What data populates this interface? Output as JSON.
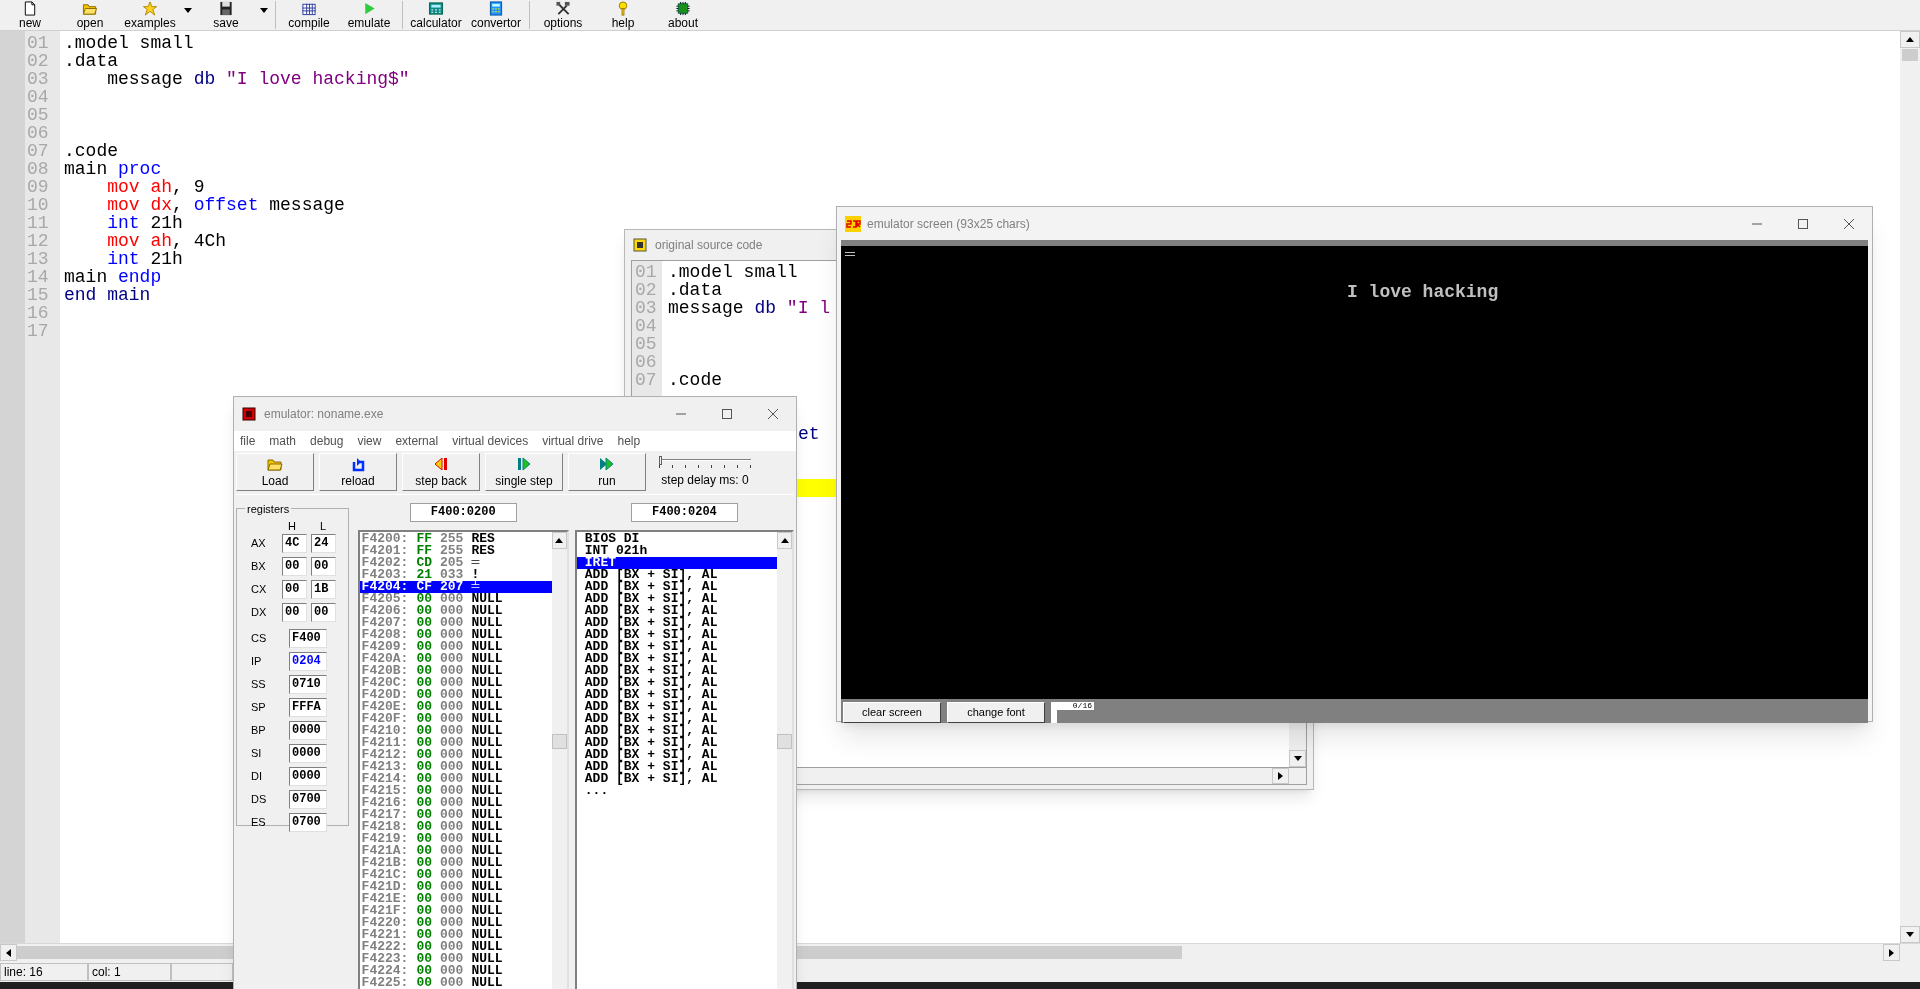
{
  "toolbar": {
    "items": [
      {
        "label": "new",
        "dropdown": false,
        "separator_after": false
      },
      {
        "label": "open",
        "dropdown": false,
        "separator_after": false
      },
      {
        "label": "examples",
        "dropdown": true,
        "separator_after": false
      },
      {
        "label": "save",
        "dropdown": true,
        "separator_after": true
      },
      {
        "label": "compile",
        "dropdown": false,
        "separator_after": false
      },
      {
        "label": "emulate",
        "dropdown": false,
        "separator_after": true
      },
      {
        "label": "calculator",
        "dropdown": false,
        "separator_after": false
      },
      {
        "label": "convertor",
        "dropdown": false,
        "separator_after": true
      },
      {
        "label": "options",
        "dropdown": false,
        "separator_after": false
      },
      {
        "label": "help",
        "dropdown": false,
        "separator_after": false
      },
      {
        "label": "about",
        "dropdown": false,
        "separator_after": false
      }
    ]
  },
  "editor": {
    "lines": [
      {
        "number": "01",
        "tokens": [
          {
            "text": ".model small",
            "kind": "plain"
          }
        ]
      },
      {
        "number": "02",
        "tokens": [
          {
            "text": ".data",
            "kind": "plain"
          }
        ]
      },
      {
        "number": "03",
        "tokens": [
          {
            "text": "    message ",
            "kind": "plain"
          },
          {
            "text": "db",
            "kind": "data"
          },
          {
            "text": " \"I love hacking$\"",
            "kind": "string"
          }
        ]
      },
      {
        "number": "04"
      },
      {
        "number": "05"
      },
      {
        "number": "06"
      },
      {
        "number": "07",
        "tokens": [
          {
            "text": ".code",
            "kind": "plain"
          }
        ]
      },
      {
        "number": "08",
        "tokens": [
          {
            "text": "main ",
            "kind": "plain"
          },
          {
            "text": "proc",
            "kind": "keyword"
          }
        ]
      },
      {
        "number": "09",
        "tokens": [
          {
            "text": "    mov",
            "kind": "mnemonic"
          },
          {
            "text": " ah",
            "kind": "register"
          },
          {
            "text": ", 9",
            "kind": "plain"
          }
        ]
      },
      {
        "number": "10",
        "tokens": [
          {
            "text": "    mov",
            "kind": "mnemonic"
          },
          {
            "text": " dx",
            "kind": "register"
          },
          {
            "text": ", ",
            "kind": "plain"
          },
          {
            "text": "offset",
            "kind": "keyword"
          },
          {
            "text": " message",
            "kind": "plain"
          }
        ]
      },
      {
        "number": "11",
        "tokens": [
          {
            "text": "    int",
            "kind": "keyword"
          },
          {
            "text": " 21h",
            "kind": "plain"
          }
        ]
      },
      {
        "number": "12",
        "tokens": [
          {
            "text": "    mov",
            "kind": "mnemonic"
          },
          {
            "text": " ah",
            "kind": "register"
          },
          {
            "text": ", 4Ch",
            "kind": "plain"
          }
        ]
      },
      {
        "number": "13",
        "tokens": [
          {
            "text": "    int",
            "kind": "keyword"
          },
          {
            "text": " 21h",
            "kind": "plain"
          }
        ]
      },
      {
        "number": "14",
        "tokens": [
          {
            "text": "main ",
            "kind": "plain"
          },
          {
            "text": "endp",
            "kind": "keyword"
          }
        ]
      },
      {
        "number": "15",
        "tokens": [
          {
            "text": "end main",
            "kind": "data"
          }
        ]
      },
      {
        "number": "16"
      },
      {
        "number": "17"
      }
    ]
  },
  "status_bar": {
    "line": "line: 16",
    "col": "col: 1"
  },
  "source_window": {
    "title": "original source code",
    "rows": [
      {
        "kind": "line",
        "number": "01",
        "tokens": [
          {
            "text": ".model small",
            "kind": "plain"
          }
        ]
      },
      {
        "kind": "line",
        "number": "02",
        "tokens": [
          {
            "text": ".data",
            "kind": "plain"
          }
        ]
      },
      {
        "kind": "line",
        "number": "03",
        "tokens": [
          {
            "text": "message ",
            "kind": "plain"
          },
          {
            "text": "db",
            "kind": "data"
          },
          {
            "text": " \"I l",
            "kind": "string"
          }
        ]
      },
      {
        "kind": "line",
        "number": "04"
      },
      {
        "kind": "line",
        "number": "05"
      },
      {
        "kind": "line",
        "number": "06"
      },
      {
        "kind": "line",
        "number": "07",
        "tokens": [
          {
            "text": ".code",
            "kind": "plain"
          }
        ]
      },
      {
        "kind": "covered"
      },
      {
        "kind": "covered"
      },
      {
        "kind": "fragment",
        "text": "et"
      },
      {
        "kind": "covered"
      },
      {
        "kind": "covered"
      },
      {
        "kind": "highlight"
      }
    ]
  },
  "emulator_window": {
    "title": "emulator: noname.exe",
    "menu": [
      "file",
      "math",
      "debug",
      "view",
      "external",
      "virtual devices",
      "virtual drive",
      "help"
    ],
    "buttons": [
      "Load",
      "reload",
      "step back",
      "single step",
      "run"
    ],
    "step_delay": {
      "label": "step delay ms: 0",
      "level": 0
    },
    "registers_title": "registers",
    "high_header": "H",
    "low_header": "L",
    "registers": [
      {
        "kind": "split",
        "name": "AX",
        "high": "4C",
        "low": "24"
      },
      {
        "kind": "split",
        "name": "BX",
        "high": "00",
        "low": "00"
      },
      {
        "kind": "split",
        "name": "CX",
        "high": "00",
        "low": "1B"
      },
      {
        "kind": "split",
        "name": "DX",
        "high": "00",
        "low": "00"
      },
      {
        "kind": "word",
        "name": "CS",
        "value": "F400",
        "changed": false
      },
      {
        "kind": "word",
        "name": "IP",
        "value": "0204",
        "changed": true
      },
      {
        "kind": "word",
        "name": "SS",
        "value": "0710",
        "changed": false
      },
      {
        "kind": "word",
        "name": "SP",
        "value": "FFFA",
        "changed": false
      },
      {
        "kind": "word",
        "name": "BP",
        "value": "0000",
        "changed": false
      },
      {
        "kind": "word",
        "name": "SI",
        "value": "0000",
        "changed": false
      },
      {
        "kind": "word",
        "name": "DI",
        "value": "0000",
        "changed": false
      },
      {
        "kind": "word",
        "name": "DS",
        "value": "0700",
        "changed": false
      },
      {
        "kind": "word",
        "name": "ES",
        "value": "0700",
        "changed": false
      }
    ],
    "memory_address": "F400:0200",
    "memory": [
      {
        "address": "F4200:",
        "hex": "FF",
        "dec": "255",
        "char": "RES",
        "selected": false
      },
      {
        "address": "F4201:",
        "hex": "FF",
        "dec": "255",
        "char": "RES",
        "selected": false
      },
      {
        "address": "F4202:",
        "hex": "CD",
        "dec": "205",
        "char": "═",
        "selected": false
      },
      {
        "address": "F4203:",
        "hex": "21",
        "dec": "033",
        "char": "!",
        "selected": false
      },
      {
        "address": "F4204:",
        "hex": "CF",
        "dec": "207",
        "char": "╧",
        "selected": true
      },
      {
        "address": "F4205:",
        "hex": "00",
        "dec": "000",
        "char": "NULL",
        "selected": false
      },
      {
        "address": "F4206:",
        "hex": "00",
        "dec": "000",
        "char": "NULL",
        "selected": false
      },
      {
        "address": "F4207:",
        "hex": "00",
        "dec": "000",
        "char": "NULL",
        "selected": false
      },
      {
        "address": "F4208:",
        "hex": "00",
        "dec": "000",
        "char": "NULL",
        "selected": false
      },
      {
        "address": "F4209:",
        "hex": "00",
        "dec": "000",
        "char": "NULL",
        "selected": false
      },
      {
        "address": "F420A:",
        "hex": "00",
        "dec": "000",
        "char": "NULL",
        "selected": false
      },
      {
        "address": "F420B:",
        "hex": "00",
        "dec": "000",
        "char": "NULL",
        "selected": false
      },
      {
        "address": "F420C:",
        "hex": "00",
        "dec": "000",
        "char": "NULL",
        "selected": false
      },
      {
        "address": "F420D:",
        "hex": "00",
        "dec": "000",
        "char": "NULL",
        "selected": false
      },
      {
        "address": "F420E:",
        "hex": "00",
        "dec": "000",
        "char": "NULL",
        "selected": false
      },
      {
        "address": "F420F:",
        "hex": "00",
        "dec": "000",
        "char": "NULL",
        "selected": false
      },
      {
        "address": "F4210:",
        "hex": "00",
        "dec": "000",
        "char": "NULL",
        "selected": false
      },
      {
        "address": "F4211:",
        "hex": "00",
        "dec": "000",
        "char": "NULL",
        "selected": false
      },
      {
        "address": "F4212:",
        "hex": "00",
        "dec": "000",
        "char": "NULL",
        "selected": false
      },
      {
        "address": "F4213:",
        "hex": "00",
        "dec": "000",
        "char": "NULL",
        "selected": false
      },
      {
        "address": "F4214:",
        "hex": "00",
        "dec": "000",
        "char": "NULL",
        "selected": false
      },
      {
        "address": "F4215:",
        "hex": "00",
        "dec": "000",
        "char": "NULL",
        "selected": false
      },
      {
        "address": "F4216:",
        "hex": "00",
        "dec": "000",
        "char": "NULL",
        "selected": false
      },
      {
        "address": "F4217:",
        "hex": "00",
        "dec": "000",
        "char": "NULL",
        "selected": false
      },
      {
        "address": "F4218:",
        "hex": "00",
        "dec": "000",
        "char": "NULL",
        "selected": false
      },
      {
        "address": "F4219:",
        "hex": "00",
        "dec": "000",
        "char": "NULL",
        "selected": false
      },
      {
        "address": "F421A:",
        "hex": "00",
        "dec": "000",
        "char": "NULL",
        "selected": false
      },
      {
        "address": "F421B:",
        "hex": "00",
        "dec": "000",
        "char": "NULL",
        "selected": false
      },
      {
        "address": "F421C:",
        "hex": "00",
        "dec": "000",
        "char": "NULL",
        "selected": false
      },
      {
        "address": "F421D:",
        "hex": "00",
        "dec": "000",
        "char": "NULL",
        "selected": false
      },
      {
        "address": "F421E:",
        "hex": "00",
        "dec": "000",
        "char": "NULL",
        "selected": false
      },
      {
        "address": "F421F:",
        "hex": "00",
        "dec": "000",
        "char": "NULL",
        "selected": false
      },
      {
        "address": "F4220:",
        "hex": "00",
        "dec": "000",
        "char": "NULL",
        "selected": false
      },
      {
        "address": "F4221:",
        "hex": "00",
        "dec": "000",
        "char": "NULL",
        "selected": false
      },
      {
        "address": "F4222:",
        "hex": "00",
        "dec": "000",
        "char": "NULL",
        "selected": false
      },
      {
        "address": "F4223:",
        "hex": "00",
        "dec": "000",
        "char": "NULL",
        "selected": false
      },
      {
        "address": "F4224:",
        "hex": "00",
        "dec": "000",
        "char": "NULL",
        "selected": false
      },
      {
        "address": "F4225:",
        "hex": "00",
        "dec": "000",
        "char": "NULL",
        "selected": false
      }
    ],
    "disassembly_address": "F400:0204",
    "disassembly": [
      {
        "text": "BIOS DI",
        "selected": false
      },
      {
        "text": "INT 021h",
        "selected": false
      },
      {
        "text": "IRET",
        "selected": true
      },
      {
        "text": "ADD [BX + SI], AL",
        "selected": false
      },
      {
        "text": "ADD [BX + SI], AL",
        "selected": false
      },
      {
        "text": "ADD [BX + SI], AL",
        "selected": false
      },
      {
        "text": "ADD [BX + SI], AL",
        "selected": false
      },
      {
        "text": "ADD [BX + SI], AL",
        "selected": false
      },
      {
        "text": "ADD [BX + SI], AL",
        "selected": false
      },
      {
        "text": "ADD [BX + SI], AL",
        "selected": false
      },
      {
        "text": "ADD [BX + SI], AL",
        "selected": false
      },
      {
        "text": "ADD [BX + SI], AL",
        "selected": false
      },
      {
        "text": "ADD [BX + SI], AL",
        "selected": false
      },
      {
        "text": "ADD [BX + SI], AL",
        "selected": false
      },
      {
        "text": "ADD [BX + SI], AL",
        "selected": false
      },
      {
        "text": "ADD [BX + SI], AL",
        "selected": false
      },
      {
        "text": "ADD [BX + SI], AL",
        "selected": false
      },
      {
        "text": "ADD [BX + SI], AL",
        "selected": false
      },
      {
        "text": "ADD [BX + SI], AL",
        "selected": false
      },
      {
        "text": "ADD [BX + SI], AL",
        "selected": false
      },
      {
        "text": "ADD [BX + SI], AL",
        "selected": false
      },
      {
        "text": "...",
        "selected": false
      }
    ]
  },
  "screen_window": {
    "title": "emulator screen (93x25 chars)",
    "output": "I love hacking",
    "buttons": [
      "clear screen",
      "change font"
    ],
    "page_indicator": "0/16"
  }
}
